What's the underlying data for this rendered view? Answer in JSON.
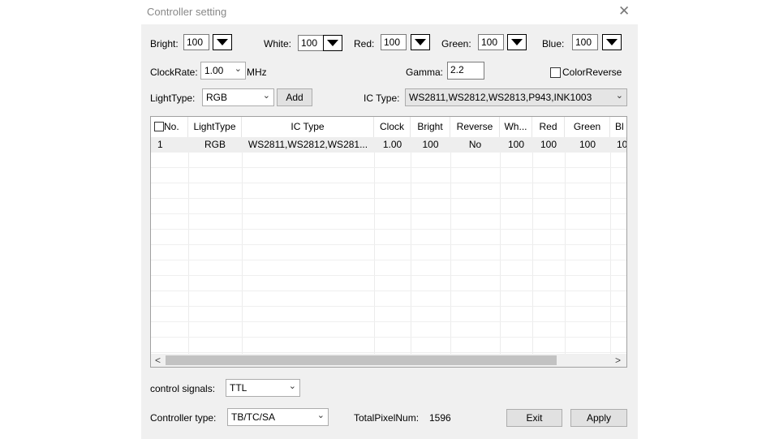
{
  "dialog": {
    "title": "Controller setting",
    "close_glyph": "✕"
  },
  "levels": {
    "bright_label": "Bright:",
    "bright_value": "100",
    "white_label": "White:",
    "white_value": "100",
    "red_label": "Red:",
    "red_value": "100",
    "green_label": "Green:",
    "green_value": "100",
    "blue_label": "Blue:",
    "blue_value": "100"
  },
  "clock": {
    "label": "ClockRate:",
    "value": "1.00",
    "unit": "MHz",
    "gamma_label": "Gamma:",
    "gamma_value": "2.2",
    "color_reverse_label": "ColorReverse"
  },
  "light": {
    "label": "LightType:",
    "value": "RGB",
    "add_label": "Add",
    "ic_label": "IC Type:",
    "ic_value": "WS2811,WS2812,WS2813,P943,INK1003"
  },
  "table": {
    "columns": [
      "No.",
      "LightType",
      "IC Type",
      "Clock",
      "Bright",
      "Reverse",
      "Wh...",
      "Red",
      "Green",
      "Bl"
    ],
    "rows": [
      [
        "1",
        "RGB",
        "WS2811,WS2812,WS281...",
        "1.00",
        "100",
        "No",
        "100",
        "100",
        "100",
        "10"
      ]
    ]
  },
  "footer": {
    "signals_label": "control signals:",
    "signals_value": "TTL",
    "ctype_label": "Controller type:",
    "ctype_value": "TB/TC/SA",
    "total_label": "TotalPixelNum:",
    "total_value": "1596",
    "exit_label": "Exit",
    "apply_label": "Apply"
  },
  "icons": {
    "dropdown": "triangle-down",
    "combo_arrow": "chevron-down",
    "scroll_left": "arrow-left",
    "scroll_right": "arrow-right"
  }
}
